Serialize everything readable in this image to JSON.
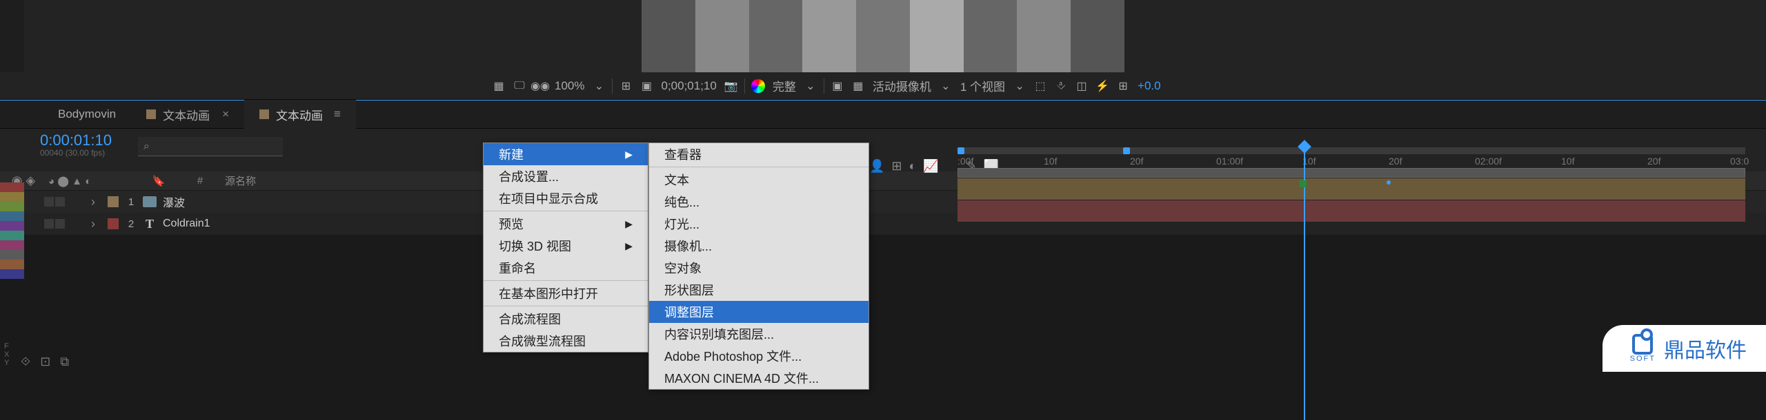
{
  "viewer_toolbar": {
    "zoom": "100%",
    "time": "0;00;01;10",
    "quality": "完整",
    "camera": "活动摄像机",
    "views": "1 个视图",
    "exposure": "+0.0"
  },
  "tabs": {
    "t1": "Bodymovin",
    "t2": "文本动画",
    "t3": "文本动画"
  },
  "timeline": {
    "timecode": "0:00:01:10",
    "subcode": "00040 (30.00 fps)",
    "col_num": "#",
    "col_source": "源名称"
  },
  "layers": [
    {
      "num": "1",
      "name": "瀑波",
      "type": "comp",
      "color": "#8b7355"
    },
    {
      "num": "2",
      "name": "Coldrain1",
      "type": "text",
      "color": "#8b3a3a"
    }
  ],
  "ruler": {
    "t0": ":00f",
    "t1": "10f",
    "t2": "20f",
    "t3": "01:00f",
    "t4": "10f",
    "t5": "20f",
    "t6": "02:00f",
    "t7": "10f",
    "t8": "20f",
    "t9": "03:0"
  },
  "context_menu_1": [
    {
      "label": "新建",
      "arrow": true,
      "hi": true
    },
    {
      "label": "合成设置...",
      "sep_after": false
    },
    {
      "label": "在项目中显示合成",
      "sep_after": true
    },
    {
      "label": "预览",
      "arrow": true
    },
    {
      "label": "切换 3D 视图",
      "arrow": true
    },
    {
      "label": "重命名",
      "sep_after": true
    },
    {
      "label": "在基本图形中打开",
      "sep_after": true
    },
    {
      "label": "合成流程图"
    },
    {
      "label": "合成微型流程图"
    }
  ],
  "context_menu_2": [
    {
      "label": "查看器",
      "sep_after": true
    },
    {
      "label": "文本"
    },
    {
      "label": "纯色..."
    },
    {
      "label": "灯光..."
    },
    {
      "label": "摄像机..."
    },
    {
      "label": "空对象"
    },
    {
      "label": "形状图层"
    },
    {
      "label": "调整图层",
      "hi": true
    },
    {
      "label": "内容识别填充图层..."
    },
    {
      "label": "Adobe Photoshop 文件..."
    },
    {
      "label": "MAXON CINEMA 4D 文件..."
    }
  ],
  "watermark": {
    "brand": "鼎品软件",
    "sub": "SOFT"
  },
  "fxy": "F\nX\nY"
}
